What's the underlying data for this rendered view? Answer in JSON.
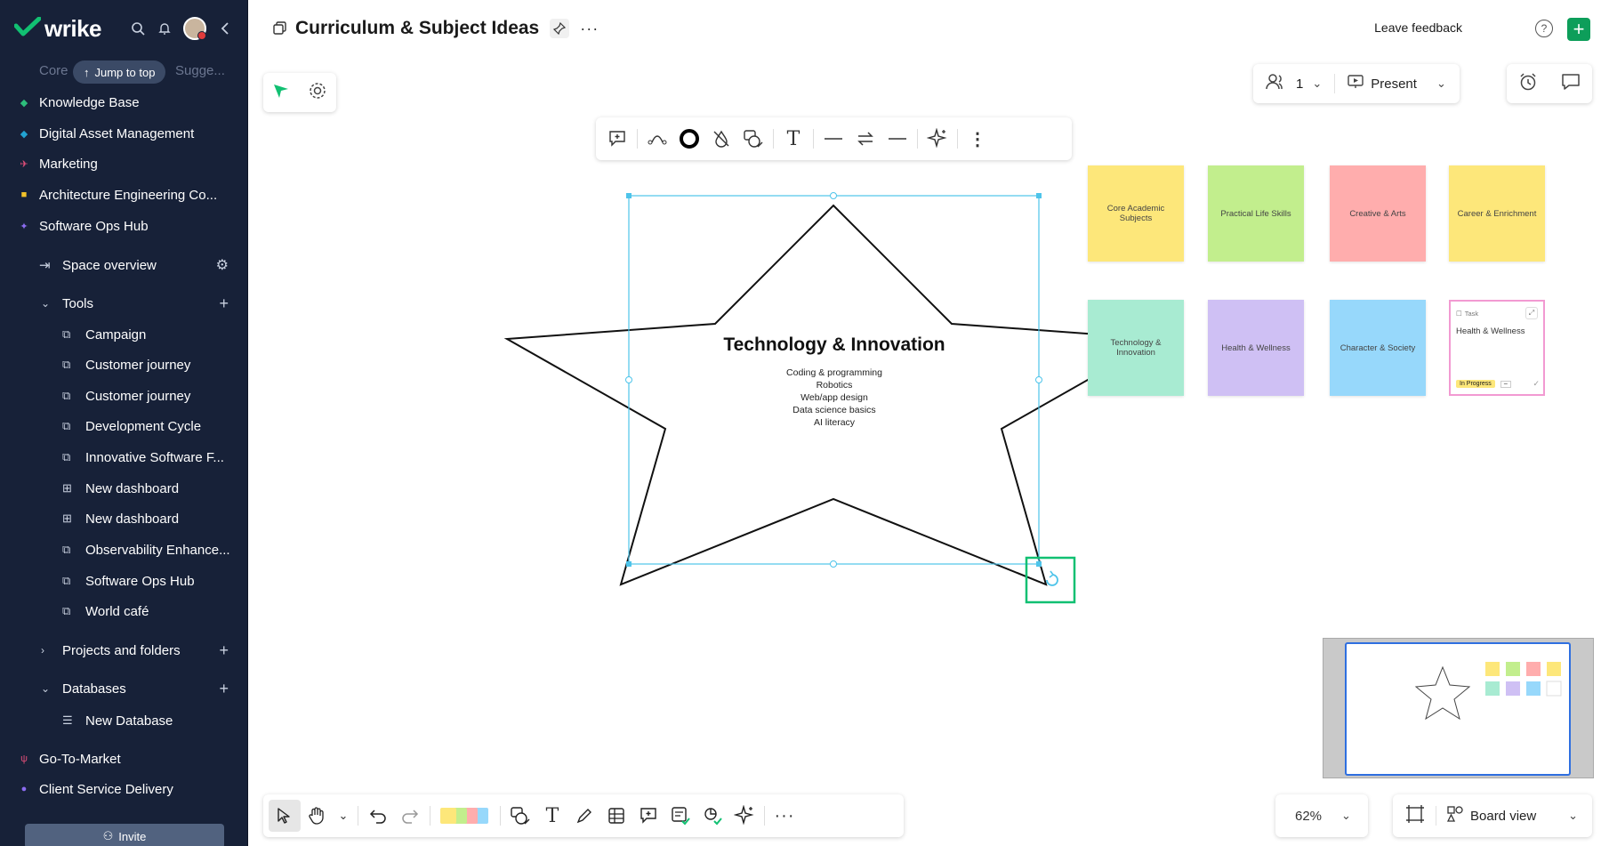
{
  "app": {
    "logo": "wrike"
  },
  "sidebar": {
    "jump_to_top": "Jump to top",
    "core_faded": "Core",
    "sugg_faded": "Sugge...",
    "spaces": [
      {
        "label": "Knowledge Base",
        "color": "#2dbe7c"
      },
      {
        "label": "Digital Asset Management",
        "color": "#22a3d1"
      },
      {
        "label": "Marketing",
        "color": "#e04e79"
      },
      {
        "label": "Architecture Engineering Co...",
        "color": "#f2c229"
      },
      {
        "label": "Software Ops Hub",
        "color": "#8b6cf0"
      }
    ],
    "space_overview": "Space overview",
    "tools_label": "Tools",
    "tools": [
      {
        "label": "Campaign",
        "icon": "whiteboard-icon"
      },
      {
        "label": "Customer journey",
        "icon": "whiteboard-icon"
      },
      {
        "label": "Customer journey",
        "icon": "whiteboard-icon"
      },
      {
        "label": "Development Cycle",
        "icon": "whiteboard-icon"
      },
      {
        "label": "Innovative Software F...",
        "icon": "whiteboard-icon"
      },
      {
        "label": "New dashboard",
        "icon": "dashboard-icon"
      },
      {
        "label": "New dashboard",
        "icon": "dashboard-icon"
      },
      {
        "label": "Observability Enhance...",
        "icon": "whiteboard-icon"
      },
      {
        "label": "Software Ops Hub",
        "icon": "whiteboard-icon"
      },
      {
        "label": "World café",
        "icon": "whiteboard-icon"
      }
    ],
    "projects_label": "Projects and folders",
    "databases_label": "Databases",
    "databases": [
      {
        "label": "New Database"
      }
    ],
    "more_spaces": [
      {
        "label": "Go-To-Market",
        "color": "#e04e79"
      },
      {
        "label": "Client Service Delivery",
        "color": "#8b6cf0"
      }
    ],
    "invite": "Invite"
  },
  "header": {
    "title": "Curriculum & Subject Ideas",
    "leave_feedback": "Leave feedback",
    "help": "?",
    "add": "+"
  },
  "canvas": {
    "collaborators_count": "1",
    "present_label": "Present",
    "star": {
      "title": "Technology & Innovation",
      "lines": [
        "Coding & programming",
        "Robotics",
        "Web/app design",
        "Data science basics",
        "AI literacy"
      ]
    },
    "stickies_row1": [
      {
        "label": "Core Academic Subjects",
        "color": "#fde77a"
      },
      {
        "label": "Practical Life Skills",
        "color": "#c2ee8d"
      },
      {
        "label": "Creative & Arts",
        "color": "#ffadad"
      },
      {
        "label": "Career & Enrichment",
        "color": "#fde77a"
      }
    ],
    "stickies_row2": [
      {
        "label": "Technology & Innovation",
        "color": "#a8ebd2"
      },
      {
        "label": "Health & Wellness",
        "color": "#cfc0f4"
      },
      {
        "label": "Character & Society",
        "color": "#97d8fb"
      }
    ],
    "task_card": {
      "type": "Task",
      "title": "Health & Wellness",
      "status": "In Progress",
      "status_color": "#fde77a"
    },
    "zoom": "62%",
    "board_view": "Board view"
  },
  "colors": {
    "sidebar_bg": "#172138",
    "accent_green": "#0d9e5a",
    "selection": "#4ec4ea"
  }
}
